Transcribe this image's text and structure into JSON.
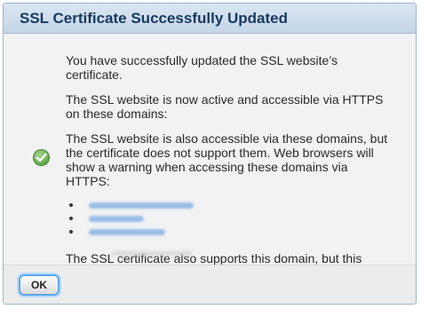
{
  "dialog": {
    "title": "SSL Certificate Successfully Updated"
  },
  "status": {
    "icon": "checkmark-success-icon",
    "color": "#5fa447"
  },
  "message": {
    "p1": "You have successfully updated the SSL website’s certificate.",
    "p2": "The SSL website is now active and accessible via HTTPS on these domains:",
    "p3": "The SSL website is also accessible via these domains, but the certificate does not support them. Web browsers will show a warning when accessing these domains via HTTPS:",
    "p4": "The SSL certificate also supports this domain, but this domain does not refer to the SSL website mentioned above:"
  },
  "footer": {
    "ok_label": "OK"
  },
  "colors": {
    "title_text": "#15395f",
    "title_bg": "#c4d5e8",
    "focus_ring": "#5aa6ef"
  }
}
